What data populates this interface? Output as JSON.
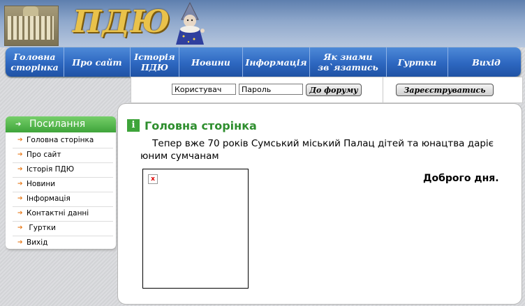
{
  "header": {
    "logo_text": "ПДЮ"
  },
  "menu": [
    {
      "label": "Головна\nсторінка"
    },
    {
      "label": "Про сайт"
    },
    {
      "label": "Історія\nПДЮ"
    },
    {
      "label": "Новини"
    },
    {
      "label": "Інформація"
    },
    {
      "label": "Як знами\nзв`язатись"
    },
    {
      "label": "Гуртки"
    },
    {
      "label": "Вихід"
    }
  ],
  "login": {
    "username_value": "Користувач",
    "password_value": "Пароль",
    "forum_button": "До форуму",
    "register_button": "Зареєструватись"
  },
  "sidebar": {
    "title": "Посилання",
    "items": [
      {
        "label": "Головна сторінка"
      },
      {
        "label": "Про сайт"
      },
      {
        "label": "Історія ПДЮ"
      },
      {
        "label": "Новини"
      },
      {
        "label": "Інформація"
      },
      {
        "label": "Контактні данні"
      },
      {
        "label": " Гуртки"
      },
      {
        "label": "Вихід"
      }
    ]
  },
  "content": {
    "info_glyph": "i",
    "title": "Головна сторінка",
    "intro": "Тепер вже 70 років Сумський міський Палац дітей та юнацтва даріє юним сумчанам",
    "greeting": "Доброго дня.",
    "broken_glyph": "x"
  },
  "colors": {
    "menu_blue": "#2d67c0",
    "green": "#3ea43a",
    "title_green": "#2e8e2e",
    "logo_gold": "#e9c24a"
  }
}
